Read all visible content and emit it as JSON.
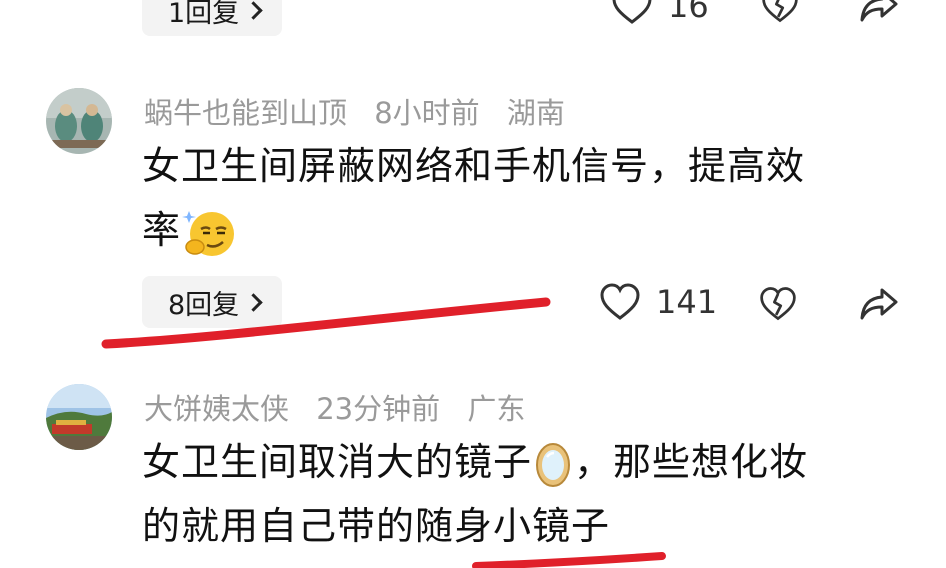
{
  "top_partial": {
    "reply_label": "1回复",
    "like_count": "16"
  },
  "comments": [
    {
      "username": "蜗牛也能到山顶",
      "time": "8小时前",
      "location": "湖南",
      "text_line1": "女卫生间屏蔽网络和手机信号，提高效",
      "text_line2": "率",
      "emoji": "smirk-face-emoji",
      "reply_label": "8回复",
      "like_count": "141"
    },
    {
      "username": "大饼姨太侠",
      "time": "23分钟前",
      "location": "广东",
      "text_line1a": "女卫生间取消大的镜子",
      "text_line1b": "，那些想化妆",
      "text_line2": "的就用自己带的随身小镜子",
      "emoji": "mirror-emoji"
    }
  ],
  "colors": {
    "meta_gray": "#9a9a9a",
    "text": "#111111",
    "pill_bg": "#f3f3f3",
    "annotation_red": "#e0202a"
  }
}
